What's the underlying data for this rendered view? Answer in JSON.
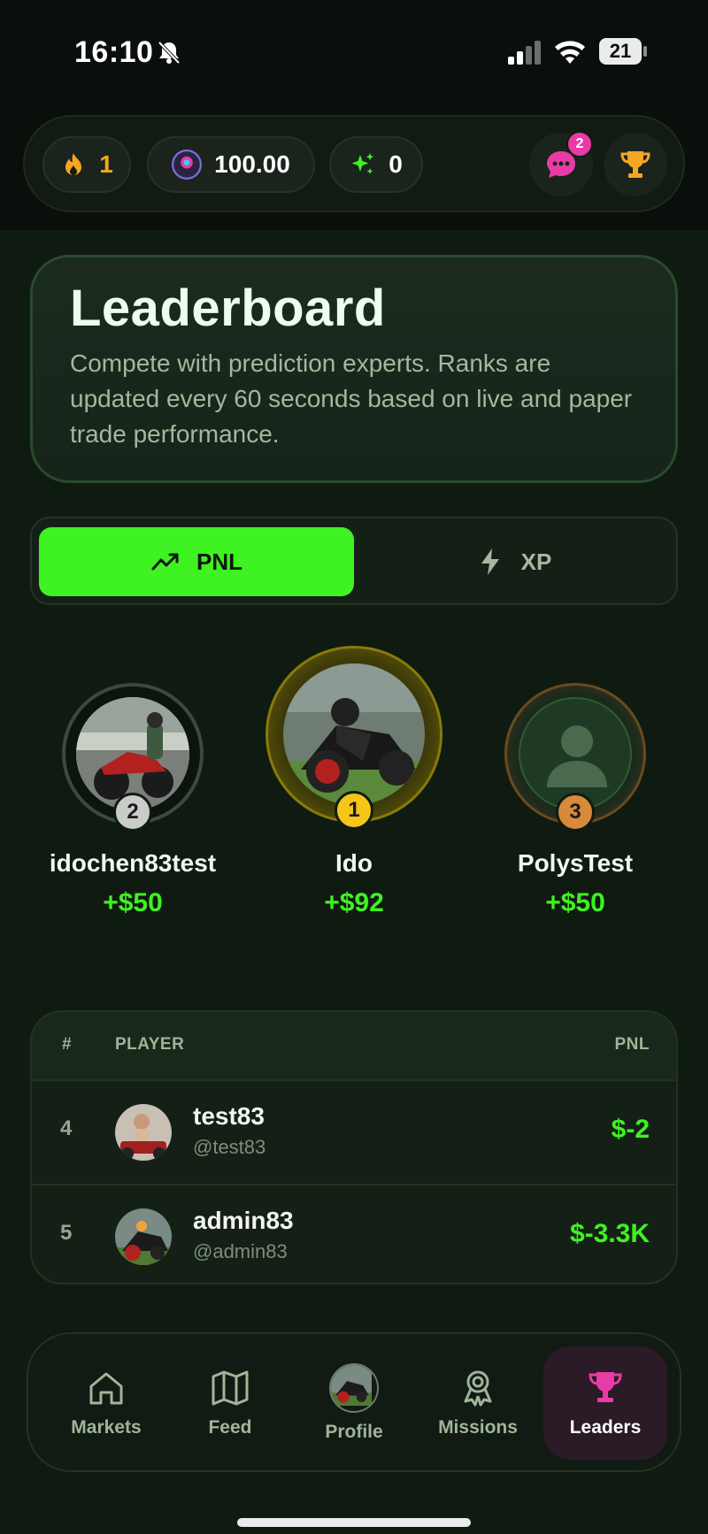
{
  "status_bar": {
    "time": "16:10",
    "battery": "21"
  },
  "header": {
    "streak": "1",
    "coins": "100.00",
    "coin_logo": "POLYS",
    "sparks": "0",
    "chat_badge": "2"
  },
  "hero": {
    "title": "Leaderboard",
    "subtitle": "Compete with prediction experts. Ranks are updated every 60 seconds based on live and paper trade performance."
  },
  "toggle": {
    "pnl_label": "PNL",
    "xp_label": "XP",
    "active": "PNL"
  },
  "podium": [
    {
      "rank": "2",
      "name": "idochen83test",
      "pnl": "+$50"
    },
    {
      "rank": "1",
      "name": "Ido",
      "pnl": "+$92"
    },
    {
      "rank": "3",
      "name": "PolysTest",
      "pnl": "+$50"
    }
  ],
  "table": {
    "headers": {
      "rank": "#",
      "player": "PLAYER",
      "pnl": "PNL"
    },
    "rows": [
      {
        "rank": "4",
        "name": "test83",
        "handle": "@test83",
        "pnl": "$-2"
      },
      {
        "rank": "5",
        "name": "admin83",
        "handle": "@admin83",
        "pnl": "$-3.3K"
      }
    ]
  },
  "nav": {
    "items": [
      {
        "label": "Markets"
      },
      {
        "label": "Feed"
      },
      {
        "label": "Profile"
      },
      {
        "label": "Missions"
      },
      {
        "label": "Leaders"
      }
    ],
    "active": "Leaders"
  },
  "colors": {
    "accent_green": "#3ff221",
    "gold": "#f5c518",
    "silver": "#c9ccc9",
    "bronze": "#d68a3a",
    "pink": "#e93ba6"
  }
}
